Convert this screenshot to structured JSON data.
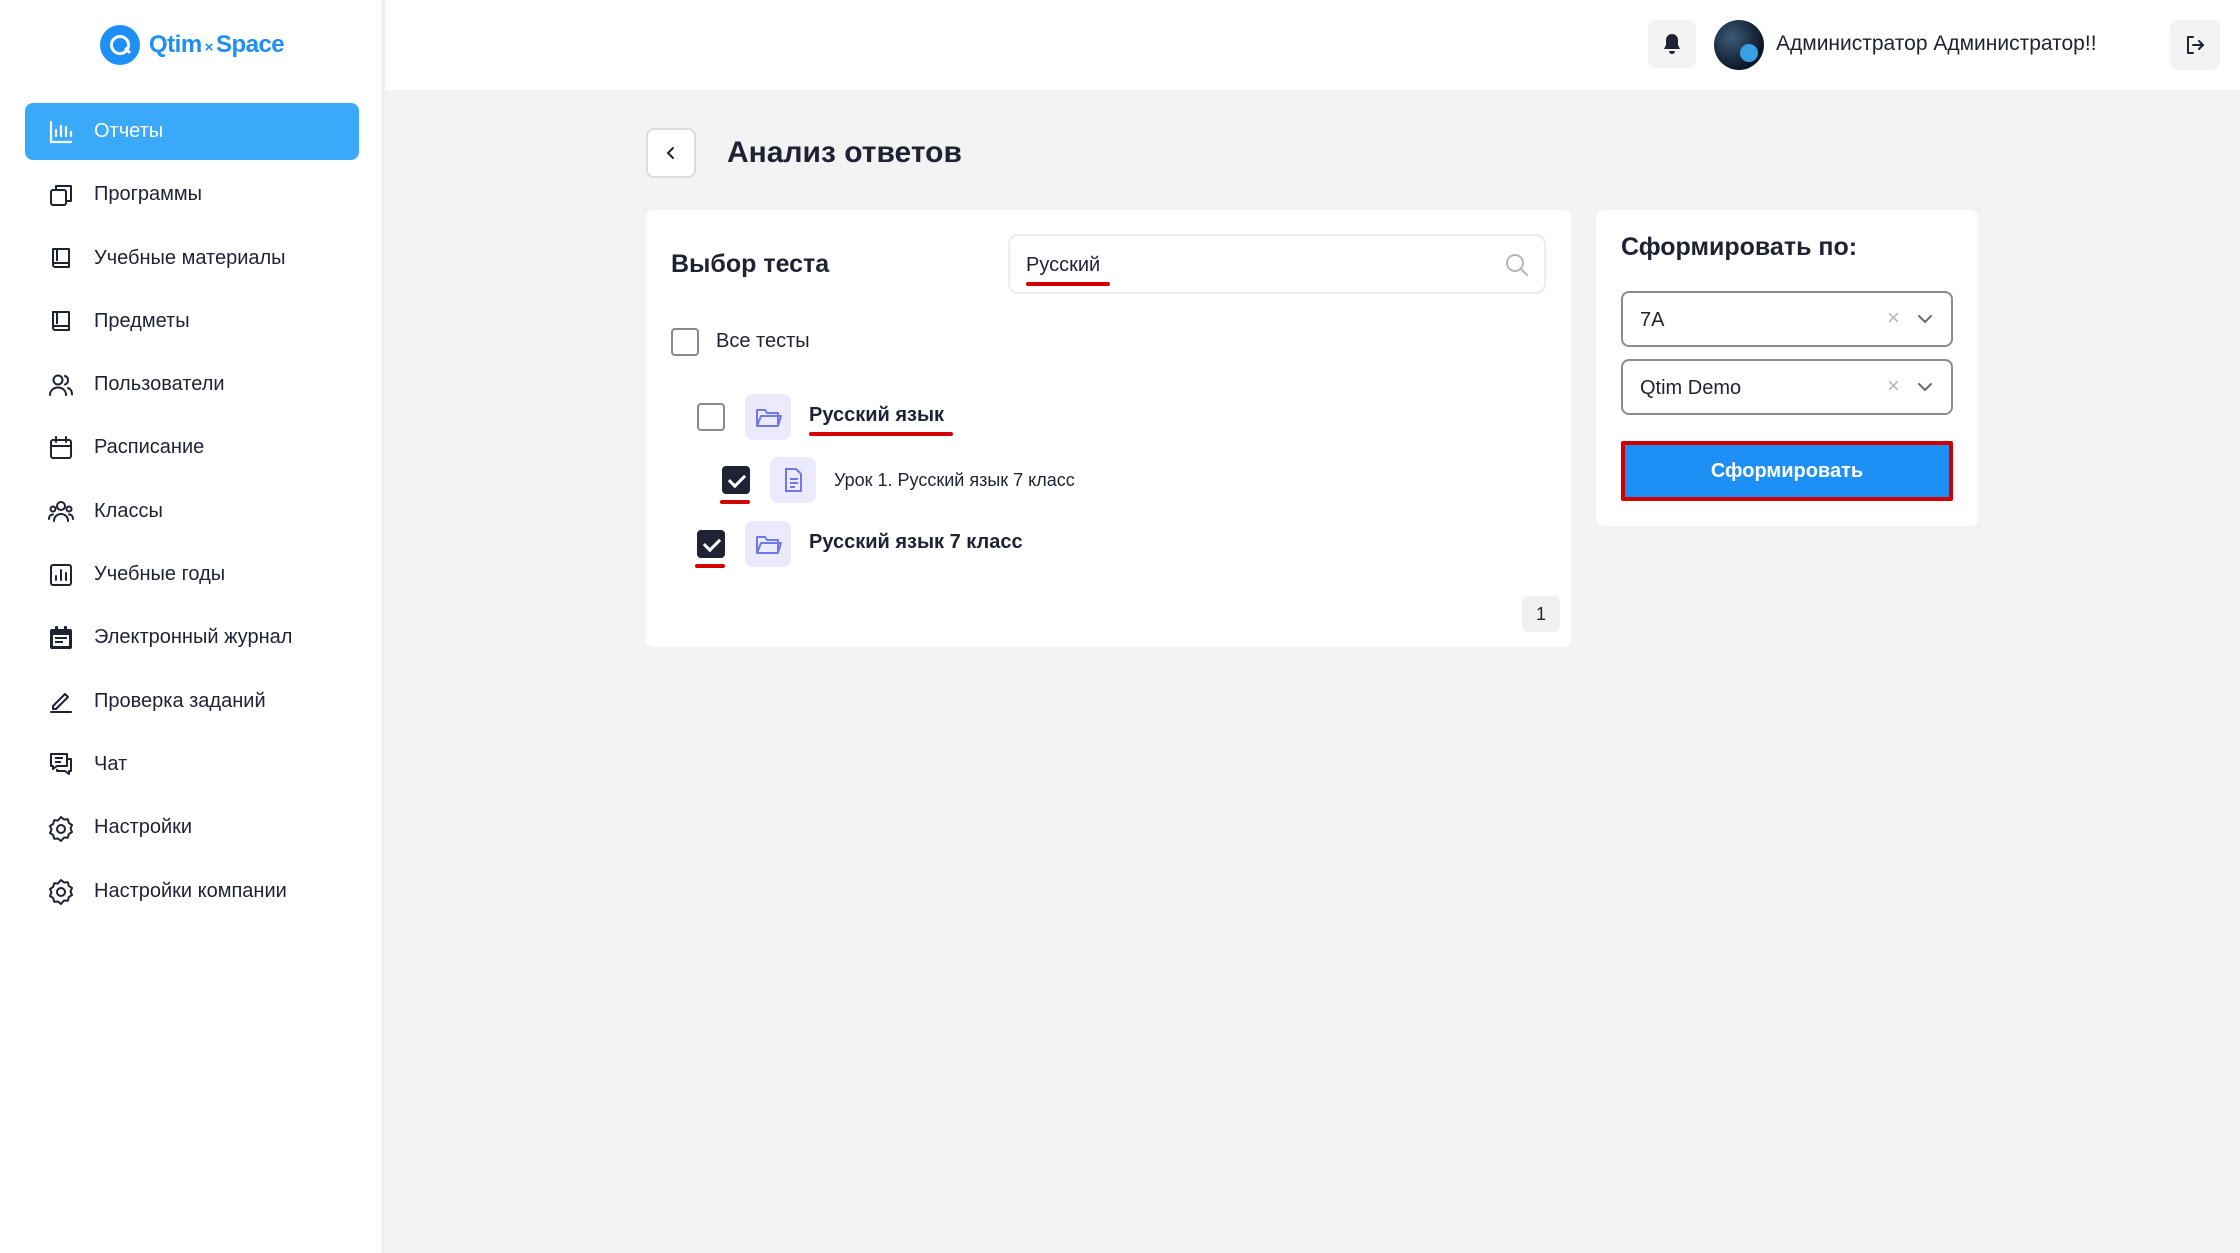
{
  "brand": {
    "name_left": "Qtim",
    "separator": "×",
    "name_right": "Space",
    "accent": "#1e8ff5"
  },
  "sidebar": {
    "items": [
      {
        "label": "Отчеты",
        "icon": "bar-chart-icon",
        "active": true
      },
      {
        "label": "Программы",
        "icon": "copy-icon",
        "active": false
      },
      {
        "label": "Учебные материалы",
        "icon": "book-icon",
        "active": false
      },
      {
        "label": "Предметы",
        "icon": "book-icon",
        "active": false
      },
      {
        "label": "Пользователи",
        "icon": "users-icon",
        "active": false
      },
      {
        "label": "Расписание",
        "icon": "calendar-icon",
        "active": false
      },
      {
        "label": "Классы",
        "icon": "group-icon",
        "active": false
      },
      {
        "label": "Учебные годы",
        "icon": "chart-box-icon",
        "active": false
      },
      {
        "label": "Электронный журнал",
        "icon": "journal-icon",
        "active": false
      },
      {
        "label": "Проверка заданий",
        "icon": "pencil-icon",
        "active": false
      },
      {
        "label": "Чат",
        "icon": "chat-icon",
        "active": false
      },
      {
        "label": "Настройки",
        "icon": "gear-icon",
        "active": false
      },
      {
        "label": "Настройки компании",
        "icon": "gear-icon",
        "active": false
      }
    ]
  },
  "header": {
    "user_name": "Администратор Администратор!!"
  },
  "page": {
    "title": "Анализ ответов"
  },
  "tests": {
    "title": "Выбор теста",
    "search_value": "Русский",
    "all_label": "Все тесты",
    "tree": [
      {
        "label": "Русский язык",
        "type": "folder",
        "checked": false
      },
      {
        "label": "Урок 1. Русский язык 7 класс",
        "type": "file",
        "checked": true
      },
      {
        "label": "Русский язык 7 класс",
        "type": "folder",
        "checked": true
      }
    ],
    "page_number": "1"
  },
  "generate": {
    "title": "Сформировать по:",
    "select_class": "7А",
    "select_company": "Qtim Demo",
    "button_label": "Сформировать"
  },
  "annotation_color": "#d40000"
}
